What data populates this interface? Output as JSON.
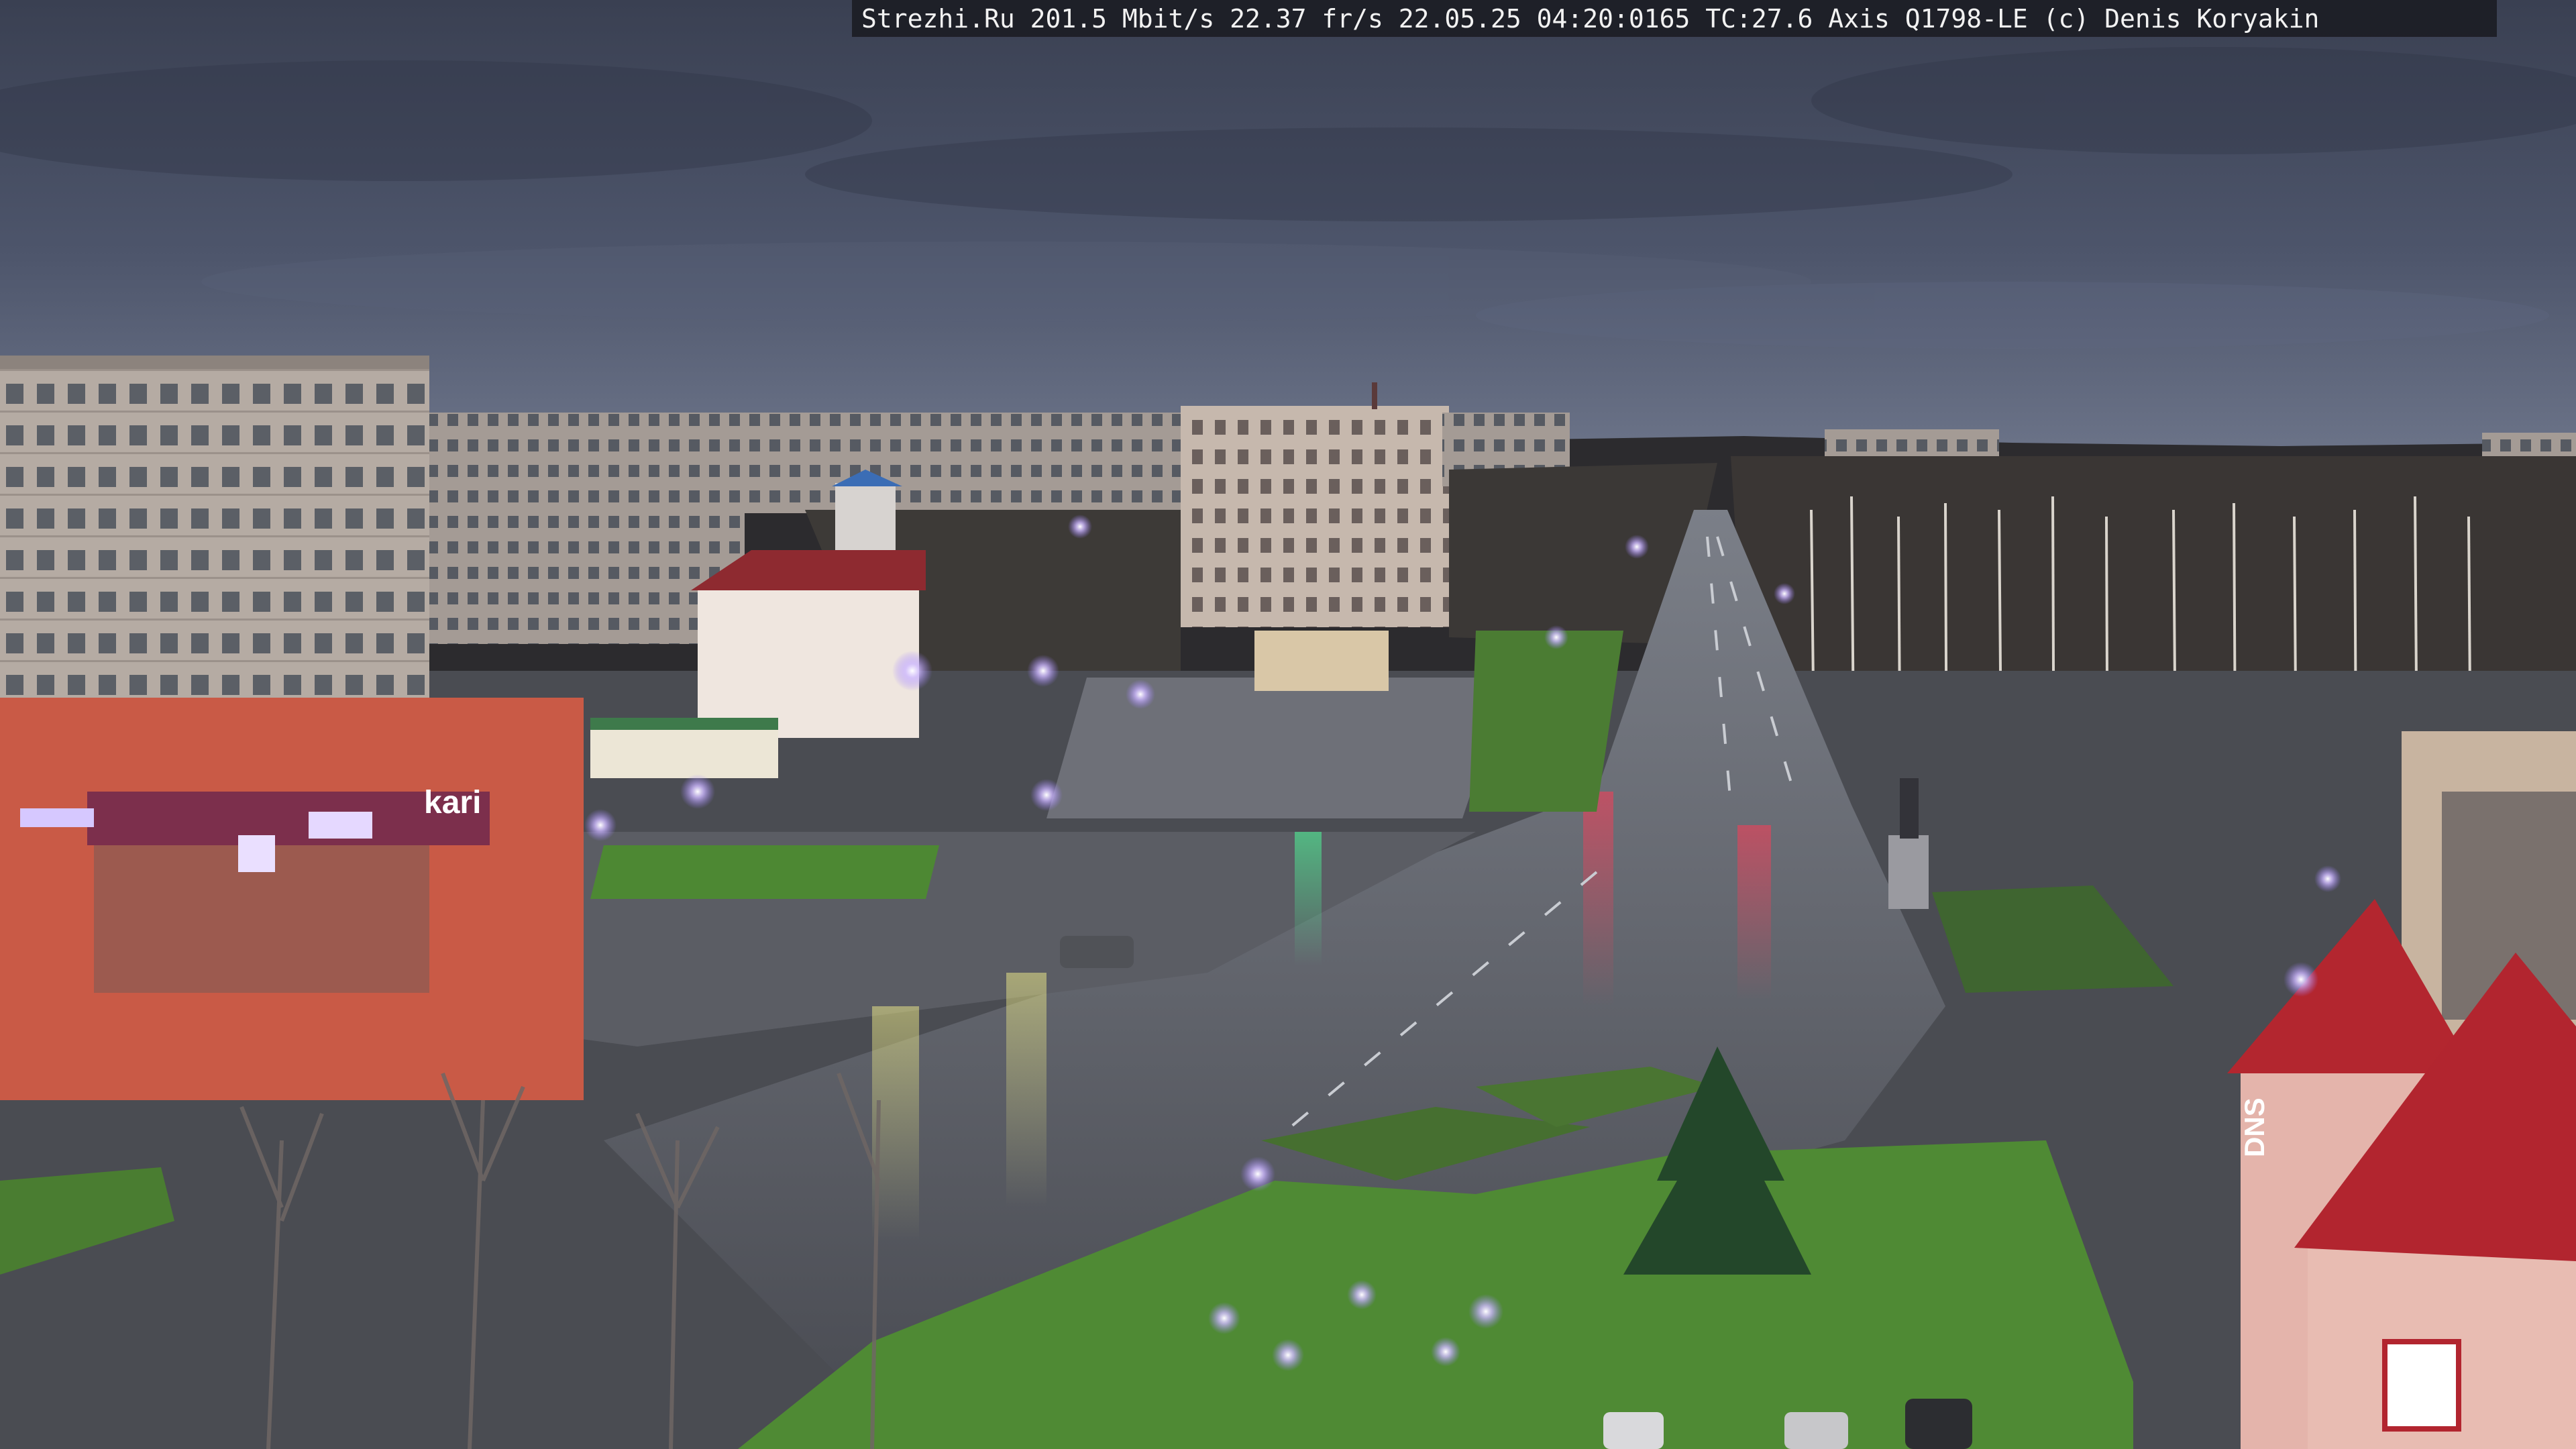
{
  "camera_overlay": {
    "text": "Strezhi.Ru 201.5 Mbit/s 22.37 fr/s 22.05.25 04:20:0165 TC:27.6  Axis Q1798-LE  (c) Denis Koryakin"
  },
  "colors": {
    "sky_top": "#3b4154",
    "sky_mid": "#4f576e",
    "sky_horizon": "#6a7389",
    "treeline": "#2b2a2c",
    "asphalt": "#4b4d55",
    "asphalt_wet": "#6b6e76",
    "grass": "#4f8a34",
    "building_panel": "#b7ada5",
    "building_red": "#c95a46",
    "roof_red": "#a82a33",
    "lamp_glow": "#d8c8ff"
  },
  "signage": {
    "store_sign_left": "kari",
    "store_sign_right": "DNS"
  }
}
